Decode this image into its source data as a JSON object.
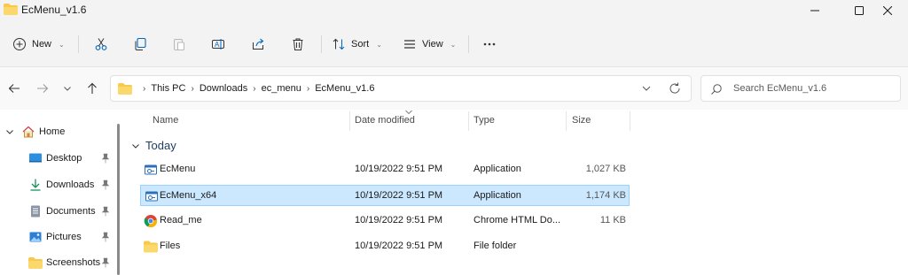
{
  "window": {
    "title": "EcMenu_v1.6"
  },
  "command_bar": {
    "new_label": "New",
    "sort_label": "Sort",
    "view_label": "View",
    "more_label": "..."
  },
  "address": {
    "crumbs": [
      "This PC",
      "Downloads",
      "ec_menu",
      "EcMenu_v1.6"
    ]
  },
  "search": {
    "placeholder": "Search EcMenu_v1.6"
  },
  "nav_pane": {
    "home_label": "Home",
    "items": [
      {
        "label": "Desktop",
        "icon": "desktop-icon"
      },
      {
        "label": "Downloads",
        "icon": "download-icon"
      },
      {
        "label": "Documents",
        "icon": "documents-icon"
      },
      {
        "label": "Pictures",
        "icon": "pictures-icon"
      },
      {
        "label": "Screenshots",
        "icon": "folder-icon"
      }
    ]
  },
  "columns": {
    "name": "Name",
    "date": "Date modified",
    "type": "Type",
    "size": "Size"
  },
  "group": {
    "label": "Today"
  },
  "files": [
    {
      "name": "EcMenu",
      "date": "10/19/2022 9:51 PM",
      "type": "Application",
      "size": "1,027 KB",
      "icon": "app-icon"
    },
    {
      "name": "EcMenu_x64",
      "date": "10/19/2022 9:51 PM",
      "type": "Application",
      "size": "1,174 KB",
      "icon": "app-icon"
    },
    {
      "name": "Read_me",
      "date": "10/19/2022 9:51 PM",
      "type": "Chrome HTML Do...",
      "size": "11 KB",
      "icon": "chrome-icon"
    },
    {
      "name": "Files",
      "date": "10/19/2022 9:51 PM",
      "type": "File folder",
      "size": "",
      "icon": "folder-icon"
    }
  ],
  "colors": {
    "selection": "#cce8ff",
    "folder": "#f8c94a",
    "accent": "#0067c0"
  }
}
